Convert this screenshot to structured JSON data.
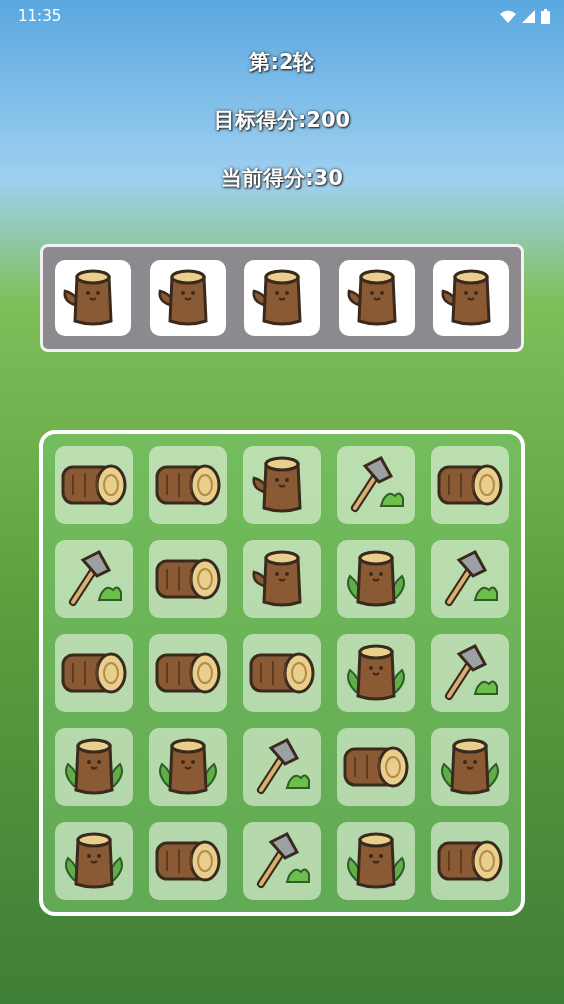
{
  "status_bar": {
    "time": "11:35"
  },
  "round": "第:2轮",
  "target_score": "目标得分:200",
  "current_score": "当前得分:30",
  "tray": [
    {
      "kind": "stump"
    },
    {
      "kind": "stump"
    },
    {
      "kind": "stump"
    },
    {
      "kind": "stump"
    },
    {
      "kind": "stump"
    }
  ],
  "board": [
    [
      {
        "kind": "log"
      },
      {
        "kind": "log"
      },
      {
        "kind": "stump"
      },
      {
        "kind": "axe"
      },
      {
        "kind": "log"
      }
    ],
    [
      {
        "kind": "axe"
      },
      {
        "kind": "log"
      },
      {
        "kind": "stump"
      },
      {
        "kind": "sprout"
      },
      {
        "kind": "axe"
      }
    ],
    [
      {
        "kind": "log"
      },
      {
        "kind": "log"
      },
      {
        "kind": "log"
      },
      {
        "kind": "sprout"
      },
      {
        "kind": "axe"
      }
    ],
    [
      {
        "kind": "sprout"
      },
      {
        "kind": "sprout"
      },
      {
        "kind": "axe"
      },
      {
        "kind": "log"
      },
      {
        "kind": "sprout"
      }
    ],
    [
      {
        "kind": "sprout"
      },
      {
        "kind": "log"
      },
      {
        "kind": "axe"
      },
      {
        "kind": "sprout"
      },
      {
        "kind": "log"
      }
    ]
  ]
}
